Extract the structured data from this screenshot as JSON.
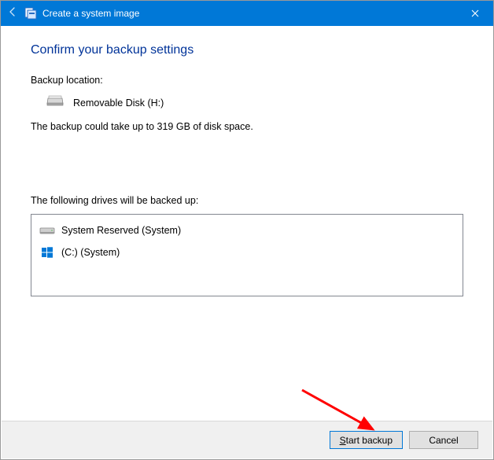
{
  "titlebar": {
    "title": "Create a system image"
  },
  "main": {
    "heading": "Confirm your backup settings",
    "backup_location_label": "Backup location:",
    "backup_location_value": "Removable Disk (H:)",
    "size_note": "The backup could take up to 319 GB of disk space.",
    "drives_label": "The following drives will be backed up:",
    "drives": [
      {
        "icon": "hdd",
        "label": "System Reserved (System)"
      },
      {
        "icon": "win",
        "label": "(C:) (System)"
      }
    ]
  },
  "buttons": {
    "start_prefix": "S",
    "start_rest": "tart backup",
    "cancel": "Cancel"
  }
}
